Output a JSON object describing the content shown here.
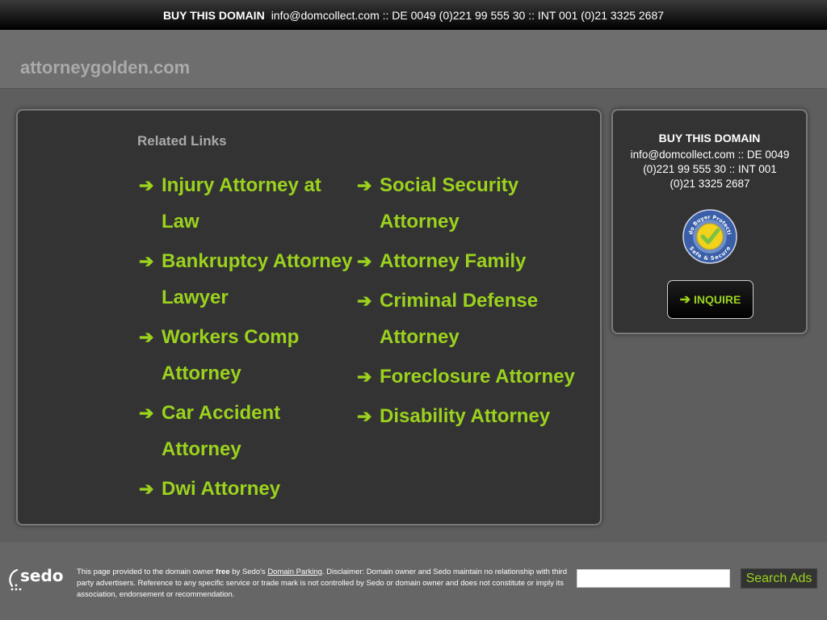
{
  "topbar": {
    "buy_label": "BUY THIS DOMAIN",
    "contact": "info@domcollect.com :: DE 0049 (0)221 99 555 30 :: INT 001 (0)21 3325 2687"
  },
  "header": {
    "domain": "attorneygolden.com"
  },
  "related": {
    "title": "Related Links",
    "col1": [
      {
        "label": "Injury Attorney at Law"
      },
      {
        "label": "Bankruptcy Attorney Lawyer"
      },
      {
        "label": "Workers Comp Attorney"
      },
      {
        "label": "Car Accident Attorney"
      },
      {
        "label": "Dwi Attorney"
      }
    ],
    "col2": [
      {
        "label": "Social Security Attorney"
      },
      {
        "label": "Attorney Family"
      },
      {
        "label": "Criminal Defense Attorney"
      },
      {
        "label": "Foreclosure Attorney"
      },
      {
        "label": "Disability Attorney"
      }
    ]
  },
  "sidebar": {
    "title": "BUY THIS DOMAIN",
    "contact": "info@domcollect.com :: DE 0049 (0)221 99 555 30 :: INT 001 (0)21 3325 2687",
    "seal_text_top": "Sedo Buyer Protection",
    "seal_text_bottom": "Safe & Secure",
    "inquire_label": "INQUIRE"
  },
  "footer": {
    "logo_text": "sedo",
    "text_1": "This page provided to the domain owner ",
    "text_free": "free",
    "text_2": " by Sedo's ",
    "text_link": "Domain Parking",
    "text_3": ". Disclaimer: Domain owner and Sedo maintain no relationship with third party advertisers. Reference to any specific service or trade mark is not controlled by Sedo or domain owner and does not constitute or imply its association, endorsement or recommendation.",
    "search_value": "",
    "search_button": "Search Ads"
  },
  "colors": {
    "accent": "#9bd21e",
    "background": "#666666",
    "panel": "#333333"
  }
}
